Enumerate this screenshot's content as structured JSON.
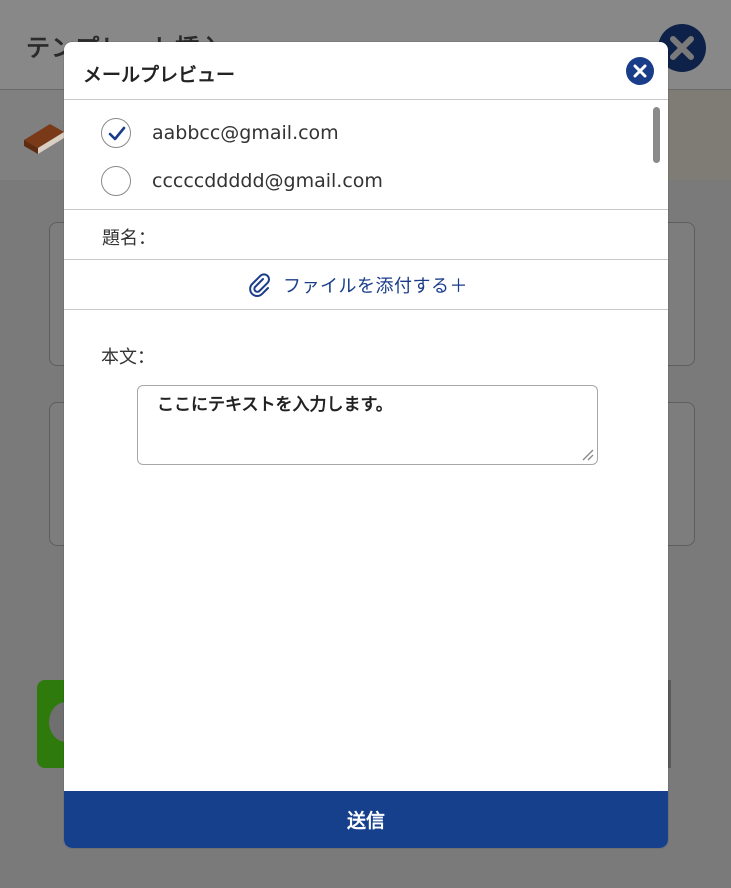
{
  "background": {
    "page_title": "テンプレート挿入"
  },
  "modal": {
    "title": "メールプレビュー",
    "recipients": [
      {
        "email": "aabbcc@gmail.com",
        "checked": true
      },
      {
        "email": "cccccddddd@gmail.com",
        "checked": false
      }
    ],
    "subject_label": "題名：",
    "attach_label": "ファイルを添付する＋",
    "body_label": "本文：",
    "body_text": "ここにテキストを入力します。",
    "send_label": "送信"
  },
  "colors": {
    "accent": "#17408c",
    "close_button": "#1a3d8a",
    "overlay_bg": "#7a7a7a"
  },
  "icons": {
    "close": "close-icon",
    "check": "checkmark-icon",
    "attach": "paperclip-icon",
    "book": "book-icon",
    "resize": "resize-grip-icon"
  }
}
